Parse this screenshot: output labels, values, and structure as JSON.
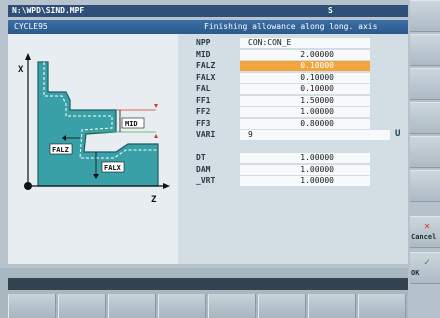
{
  "header": {
    "path": "N:\\WPD\\SIND.MPF",
    "channel": "S",
    "section": "CYCLE95",
    "description": "Finishing allowance along long. axis"
  },
  "graphic": {
    "axis_x": "X",
    "axis_z": "Z",
    "labels": {
      "mid": "MID",
      "falz": "FALZ",
      "falx": "FALX"
    }
  },
  "params": [
    {
      "label": "NPP",
      "value": "CON:CON_E",
      "kind": "text"
    },
    {
      "label": "MID",
      "value": "2.00000",
      "kind": "num"
    },
    {
      "label": "FALZ",
      "value": "0.10000",
      "kind": "num",
      "active": true
    },
    {
      "label": "FALX",
      "value": "0.10000",
      "kind": "num"
    },
    {
      "label": "FAL",
      "value": "0.10000",
      "kind": "num"
    },
    {
      "label": "FF1",
      "value": "1.50000",
      "kind": "num"
    },
    {
      "label": "FF2",
      "value": "1.00000",
      "kind": "num"
    },
    {
      "label": "FF3",
      "value": "0.80000",
      "kind": "num"
    },
    {
      "label": "VARI",
      "value": "9",
      "kind": "toggle",
      "toggle": "U"
    },
    {
      "label": "",
      "value": "",
      "kind": "spacer"
    },
    {
      "label": "DT",
      "value": "1.00000",
      "kind": "num"
    },
    {
      "label": "DAM",
      "value": "1.00000",
      "kind": "num"
    },
    {
      "label": "_VRT",
      "value": "1.00000",
      "kind": "num"
    }
  ],
  "softkeys_right": {
    "cancel_label": "Cancel",
    "ok_label": "OK",
    "cancel_color": "#d23a2a",
    "ok_color": "#2f9a3a"
  },
  "colors": {
    "active_field": "#f2a53c",
    "title_bar": "#2b5a8c",
    "workpiece": "#3aa0a8"
  }
}
